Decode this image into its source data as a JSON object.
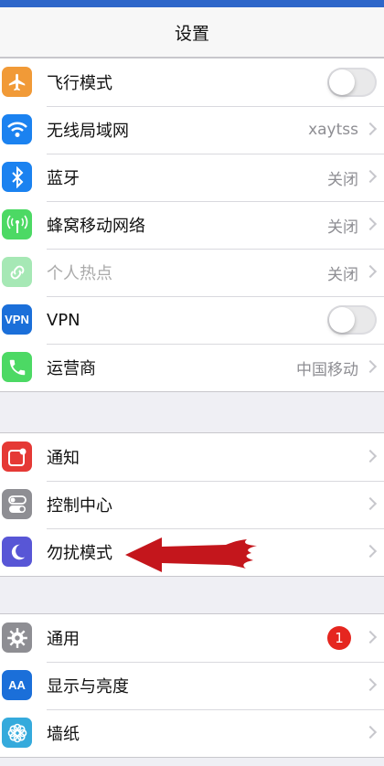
{
  "statusbar": {
    "color": "#2e66c9"
  },
  "nav": {
    "title": "设置"
  },
  "group1": [
    {
      "label": "飞行模式",
      "icon": "airplane-icon",
      "color": "#f19a37",
      "toggle": true
    },
    {
      "label": "无线局域网",
      "icon": "wifi-icon",
      "color": "#1b82f0",
      "value": "xaytss"
    },
    {
      "label": "蓝牙",
      "icon": "bluetooth-icon",
      "color": "#1b82f0",
      "value": "关闭"
    },
    {
      "label": "蜂窝移动网络",
      "icon": "cellular-icon",
      "color": "#4cd964",
      "value": "关闭"
    },
    {
      "label": "个人热点",
      "icon": "hotspot-icon",
      "color": "#a6e8b5",
      "value": "关闭",
      "disabled": true
    },
    {
      "label": "VPN",
      "icon": "vpn-icon",
      "color": "#1b6fd9",
      "icon_text": "VPN",
      "toggle": true
    },
    {
      "label": "运营商",
      "icon": "phone-icon",
      "color": "#4cd964",
      "value": "中国移动"
    }
  ],
  "group2": [
    {
      "label": "通知",
      "icon": "notifications-icon",
      "color": "#e53935"
    },
    {
      "label": "控制中心",
      "icon": "control-center-icon",
      "color": "#8e8e93"
    },
    {
      "label": "勿扰模式",
      "icon": "moon-icon",
      "color": "#5856d6"
    }
  ],
  "group3": [
    {
      "label": "通用",
      "icon": "gear-icon",
      "color": "#8e8e93",
      "badge": "1"
    },
    {
      "label": "显示与亮度",
      "icon": "display-icon",
      "color": "#1b6fd9",
      "icon_text": "AA"
    },
    {
      "label": "墙纸",
      "icon": "wallpaper-icon",
      "color": "#35aadc"
    }
  ],
  "annotation": {
    "arrow_color": "#c4161c"
  }
}
